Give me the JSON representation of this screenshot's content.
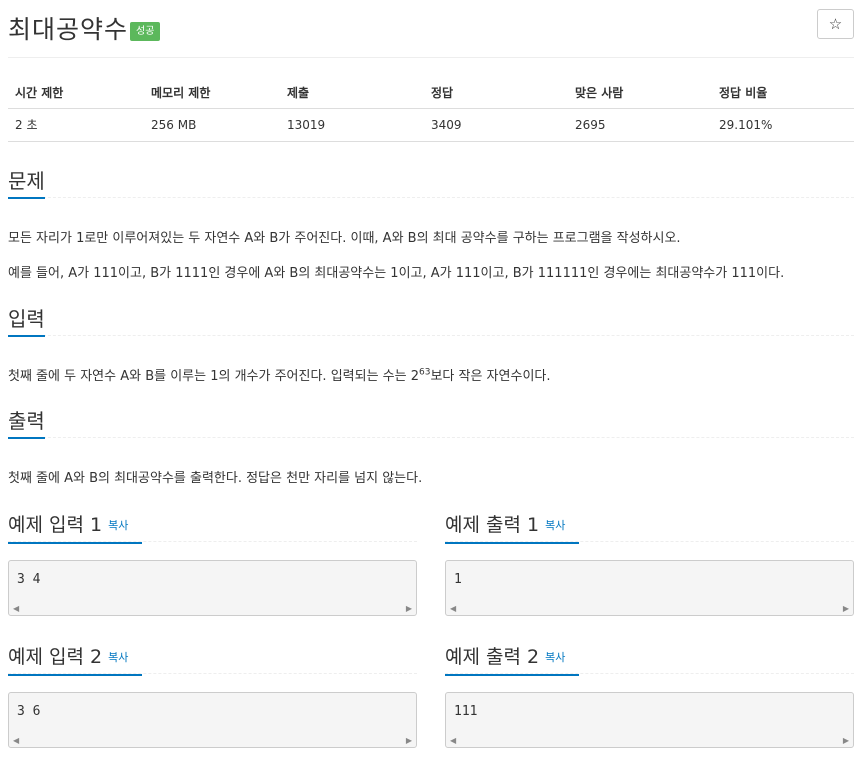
{
  "problem": {
    "title": "최대공약수",
    "badge": "성공",
    "star": "☆"
  },
  "stats": {
    "headers": [
      "시간 제한",
      "메모리 제한",
      "제출",
      "정답",
      "맞은 사람",
      "정답 비율"
    ],
    "values": [
      "2 초",
      "256 MB",
      "13019",
      "3409",
      "2695",
      "29.101%"
    ]
  },
  "sections": {
    "problem_title": "문제",
    "problem_p1": "모든 자리가 1로만 이루어져있는 두 자연수 A와 B가 주어진다. 이때, A와 B의 최대 공약수를 구하는 프로그램을 작성하시오.",
    "problem_p2": "예를 들어, A가 111이고, B가 1111인 경우에 A와 B의 최대공약수는 1이고, A가 111이고, B가 111111인 경우에는 최대공약수가 111이다.",
    "input_title": "입력",
    "input_p_before": "첫째 줄에 두 자연수 A와 B를 이루는 1의 개수가 주어진다. 입력되는 수는 2",
    "input_p_sup": "63",
    "input_p_after": "보다 작은 자연수이다.",
    "output_title": "출력",
    "output_p": "첫째 줄에 A와 B의 최대공약수를 출력한다. 정답은 천만 자리를 넘지 않는다."
  },
  "samples": {
    "copy_label": "복사",
    "in1_title": "예제 입력 1",
    "in1_value": "3 4",
    "out1_title": "예제 출력 1",
    "out1_value": "1",
    "in2_title": "예제 입력 2",
    "in2_value": "3 6",
    "out2_title": "예제 출력 2",
    "out2_value": "111"
  }
}
